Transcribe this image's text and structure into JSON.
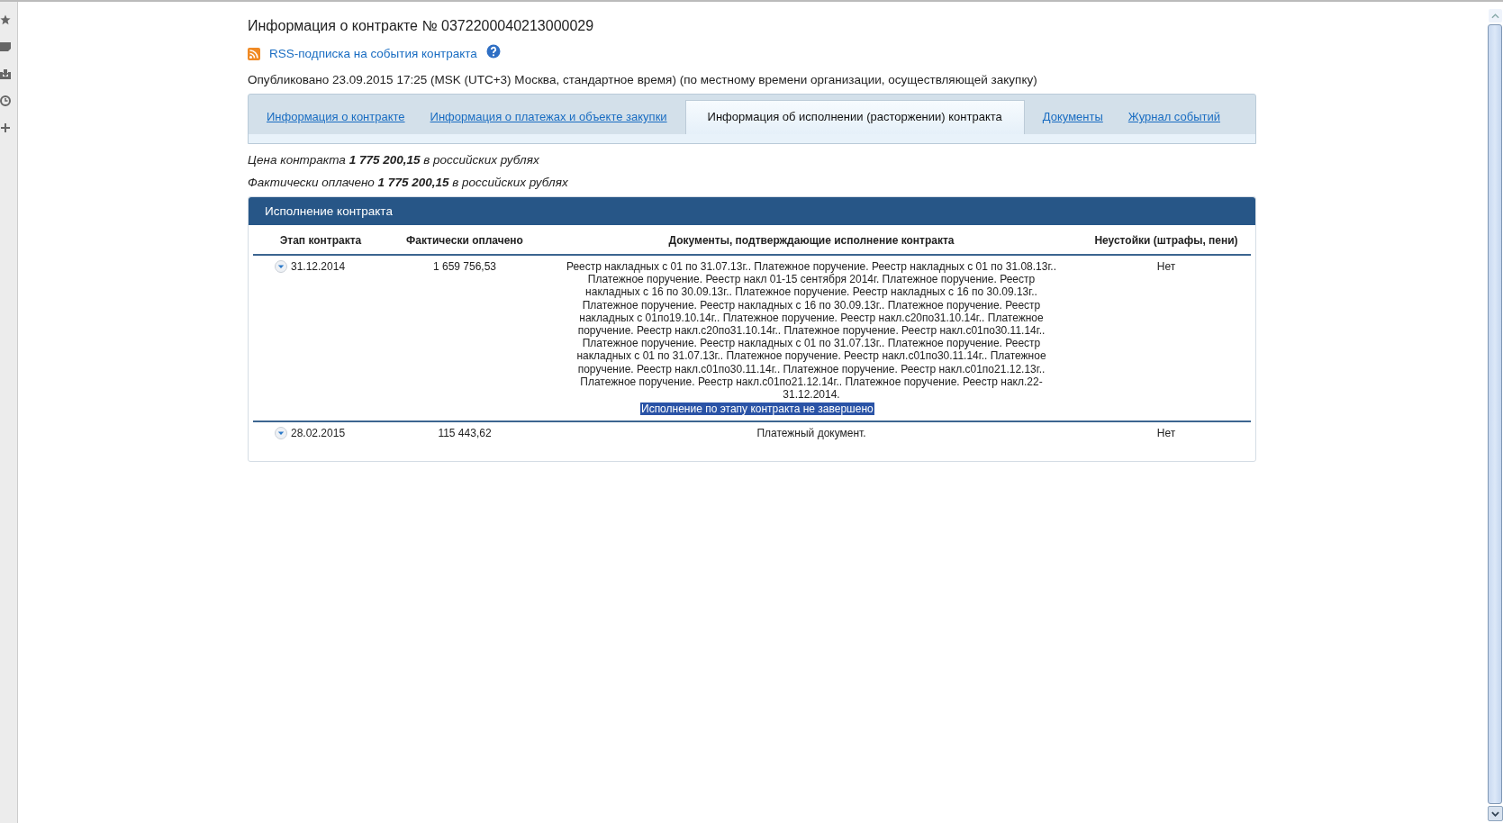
{
  "page": {
    "title": "Информация о контракте № 0372200040213000029",
    "rss_link": "RSS-подписка на события контракта",
    "published": "Опубликовано 23.09.2015 17:25 (MSK (UTC+3) Москва, стандартное время) (по местному времени организации, осуществляющей закупку)"
  },
  "tabs": [
    {
      "label": "Информация о контракте",
      "selected": false
    },
    {
      "label": "Информация о платежах и объекте закупки",
      "selected": false
    },
    {
      "label": "Информация об исполнении (расторжении) контракта",
      "selected": true
    },
    {
      "label": "Документы",
      "selected": false
    },
    {
      "label": "Журнал событий",
      "selected": false
    }
  ],
  "summary": [
    "*Цена контракта* **1 775 200,15** *в российских рублях*",
    "*Фактически оплачено* **1 775 200,15** *в российских рублях*"
  ],
  "panel": {
    "title": "Исполнение контракта",
    "columns": [
      "Этап контракта",
      "Фактически оплачено",
      "Документы, подтверждающие исполнение контракта",
      "Неустойки (штрафы, пени)"
    ],
    "rows": [
      {
        "stage": "31.12.2014",
        "paid": "1 659 756,53",
        "documents": "Реестр накладных с 01 по 31.07.13г.. Платежное поручение. Реестр накладных с 01 по 31.08.13г.. Платежное поручение. Реестр накл 01-15 сентября 2014г. Платежное поручение. Реестр накладных с 16 по 30.09.13г.. Платежное поручение. Реестр накладных с 16 по 30.09.13г.. Платежное поручение. Реестр накладных с 16 по 30.09.13г.. Платежное поручение. Реестр накладных с 01по19.10.14г.. Платежное поручение. Реестр накл.с20по31.10.14г.. Платежное поручение. Реестр накл.с20по31.10.14г.. Платежное поручение. Реестр накл.с01по30.11.14г.. Платежное поручение. Реестр накладных с 01 по 31.07.13г.. Платежное поручение. Реестр накладных с 01 по 31.07.13г.. Платежное поручение. Реестр накл.с01по30.11.14г.. Платежное поручение. Реестр накл.с01по30.11.14г.. Платежное поручение. Реестр накл.с01по21.12.13г.. Платежное поручение. Реестр накл.с01по21.12.14г.. Платежное поручение. Реестр накл.22-31.12.2014.",
        "note": {
          "text": "Исполнение по этапу контракта не завершено",
          "highlighted": true
        },
        "penalties": "Нет"
      },
      {
        "stage": "28.02.2015",
        "paid": "115 443,62",
        "documents": "Платежный документ.",
        "penalties": "Нет"
      }
    ]
  }
}
